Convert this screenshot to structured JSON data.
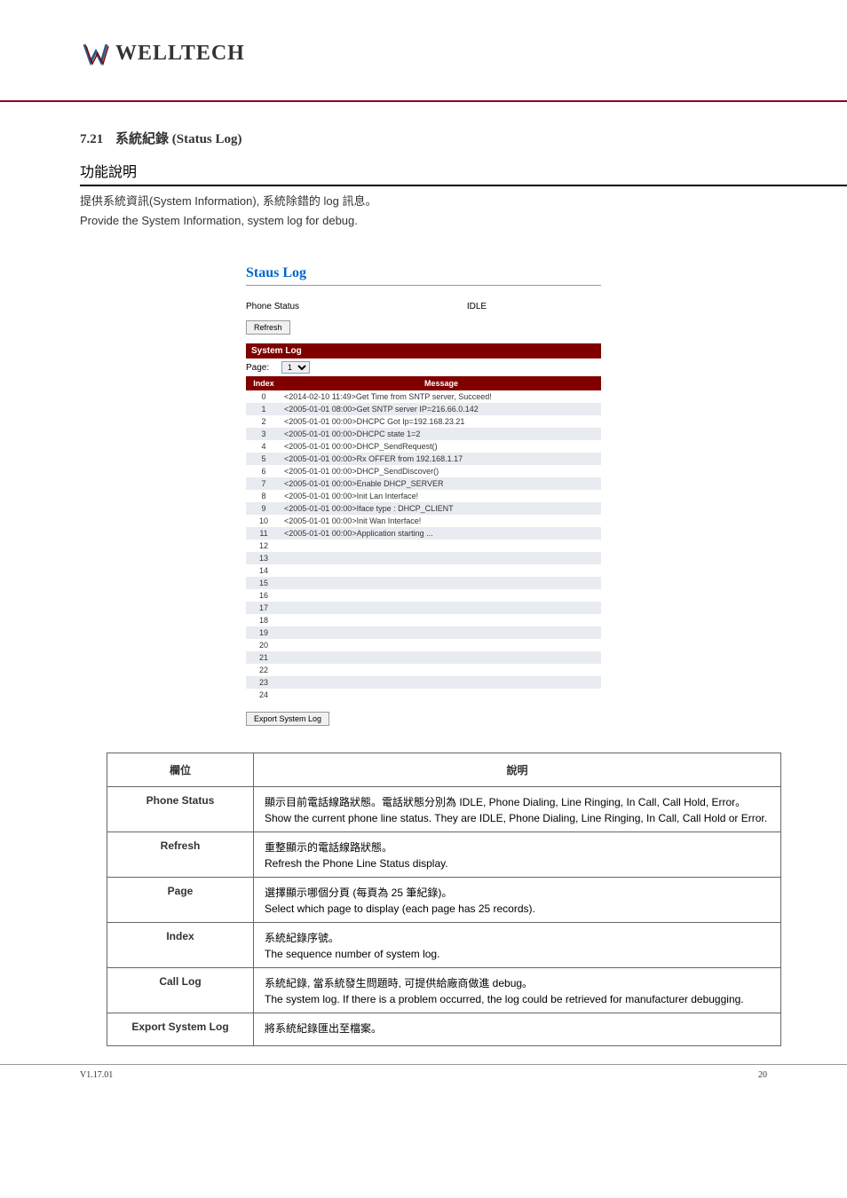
{
  "logo": {
    "brand_text": "WELLTECH"
  },
  "section": {
    "num": "7.21",
    "title_zh": "系統紀錄",
    "title_en": "(Status Log)"
  },
  "function_desc": {
    "header": "功能說明",
    "zh": "提供系統資訊(System Information), 系統除錯的 log 訊息。",
    "en": "Provide the System Information, system log for debug."
  },
  "screenshot": {
    "title": "Staus Log",
    "phone_status_label": "Phone Status",
    "phone_status_value": "IDLE",
    "refresh_label": "Refresh",
    "system_log_header": "System Log",
    "page_label": "Page:",
    "page_value": "1",
    "index_header": "Index",
    "message_header": "Message",
    "rows": [
      {
        "idx": "0",
        "msg": "<2014-02-10 11:49>Get Time from SNTP server, Succeed!"
      },
      {
        "idx": "1",
        "msg": "<2005-01-01 08:00>Get SNTP server IP=216.66.0.142"
      },
      {
        "idx": "2",
        "msg": "<2005-01-01 00:00>DHCPC Got Ip=192.168.23.21"
      },
      {
        "idx": "3",
        "msg": "<2005-01-01 00:00>DHCPC state 1=2"
      },
      {
        "idx": "4",
        "msg": "<2005-01-01 00:00>DHCP_SendRequest()"
      },
      {
        "idx": "5",
        "msg": "<2005-01-01 00:00>Rx OFFER from 192.168.1.17"
      },
      {
        "idx": "6",
        "msg": "<2005-01-01 00:00>DHCP_SendDiscover()"
      },
      {
        "idx": "7",
        "msg": "<2005-01-01 00:00>Enable DHCP_SERVER"
      },
      {
        "idx": "8",
        "msg": "<2005-01-01 00:00>Init Lan Interface!"
      },
      {
        "idx": "9",
        "msg": "<2005-01-01 00:00>Iface type : DHCP_CLIENT"
      },
      {
        "idx": "10",
        "msg": "<2005-01-01 00:00>Init Wan Interface!"
      },
      {
        "idx": "11",
        "msg": "<2005-01-01 00:00>Application starting ..."
      },
      {
        "idx": "12",
        "msg": ""
      },
      {
        "idx": "13",
        "msg": ""
      },
      {
        "idx": "14",
        "msg": ""
      },
      {
        "idx": "15",
        "msg": ""
      },
      {
        "idx": "16",
        "msg": ""
      },
      {
        "idx": "17",
        "msg": ""
      },
      {
        "idx": "18",
        "msg": ""
      },
      {
        "idx": "19",
        "msg": ""
      },
      {
        "idx": "20",
        "msg": ""
      },
      {
        "idx": "21",
        "msg": ""
      },
      {
        "idx": "22",
        "msg": ""
      },
      {
        "idx": "23",
        "msg": ""
      },
      {
        "idx": "24",
        "msg": ""
      }
    ],
    "export_label": "Export System Log"
  },
  "field_table": {
    "header_field": "欄位",
    "header_desc": "說明",
    "rows": [
      {
        "field": "Phone Status",
        "zh": "顯示目前電話線路狀態。電話狀態分別為 IDLE, Phone Dialing, Line Ringing, In Call, Call Hold, Error。",
        "en": "Show the current phone line status. They are IDLE, Phone Dialing, Line Ringing, In Call, Call Hold or Error."
      },
      {
        "field": "Refresh",
        "zh": "重整顯示的電話線路狀態。",
        "en": "Refresh the Phone Line Status display."
      },
      {
        "field": "Page",
        "zh": "選擇顯示哪個分頁 (每頁為 25 筆紀錄)。",
        "en": "Select which page to display (each page has 25 records)."
      },
      {
        "field": "Index",
        "zh": "系統紀錄序號。",
        "en": "The sequence number of system log."
      },
      {
        "field": "Call Log",
        "zh": "系統紀錄, 當系統發生問題時, 可提供給廠商做進 debug。",
        "en": "The system log. If there is a problem occurred, the log could be retrieved for manufacturer debugging."
      },
      {
        "field": "Export System Log",
        "zh": "將系統紀錄匯出至檔案。",
        "en": ""
      }
    ]
  },
  "footer": {
    "left": "V1.17.01",
    "right": "20"
  }
}
